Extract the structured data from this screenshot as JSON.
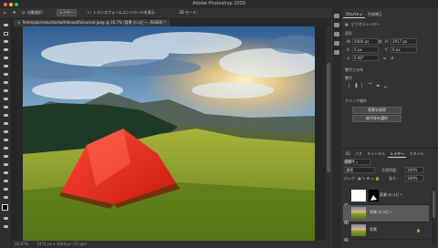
{
  "app": {
    "title": "Adobe Photoshop 2020"
  },
  "colors": {
    "window_close": "#fe5f57",
    "window_min": "#febc2e",
    "window_max": "#28c840",
    "accent": "#2d8ceb"
  },
  "options_bar": {
    "items": [
      "自動選択：",
      "レイヤー",
      "トランスフォームコントロールを表示",
      "3D モード："
    ]
  },
  "document": {
    "tab_label": "Tentinplainmountainwithbeautifulsunset.jpeg @ 16.7% (背景 のコピー, RGB/8) *"
  },
  "status": {
    "zoom": "16.67%",
    "size": "5472 px x 3648 px (72 ppi)"
  },
  "properties": {
    "tab": "プロパティ",
    "tab2": "色調補正",
    "section": "ピクセルレイヤー",
    "transform_label": "変形",
    "w_label": "W",
    "w_value": "5000 px",
    "h_label": "H",
    "h_value": "2917 px",
    "x_label": "X",
    "x_value": "0 px",
    "y_label": "Y",
    "y_value": "0 px",
    "angle_value": "0.00°",
    "align_label": "整列と分布",
    "align_sub": "整列",
    "quick_actions": "クイック操作",
    "btn_remove_bg": "背景を削除",
    "btn_select_subject": "被写体を選択"
  },
  "layers": {
    "tabs": [
      "3D",
      "パス",
      "チャンネル",
      "レイヤー",
      "スタイル",
      "色調補正"
    ],
    "active_tab": "レイヤー",
    "kind_label": "種類",
    "mode": "通常",
    "opacity_label": "不透明度：",
    "opacity": "100%",
    "lock_label": "ロック：",
    "fill_label": "塗り：",
    "fill": "100%",
    "items": [
      {
        "name": "背景 のコピー"
      },
      {
        "name": "背景 のコピー"
      },
      {
        "name": "背景"
      }
    ]
  }
}
